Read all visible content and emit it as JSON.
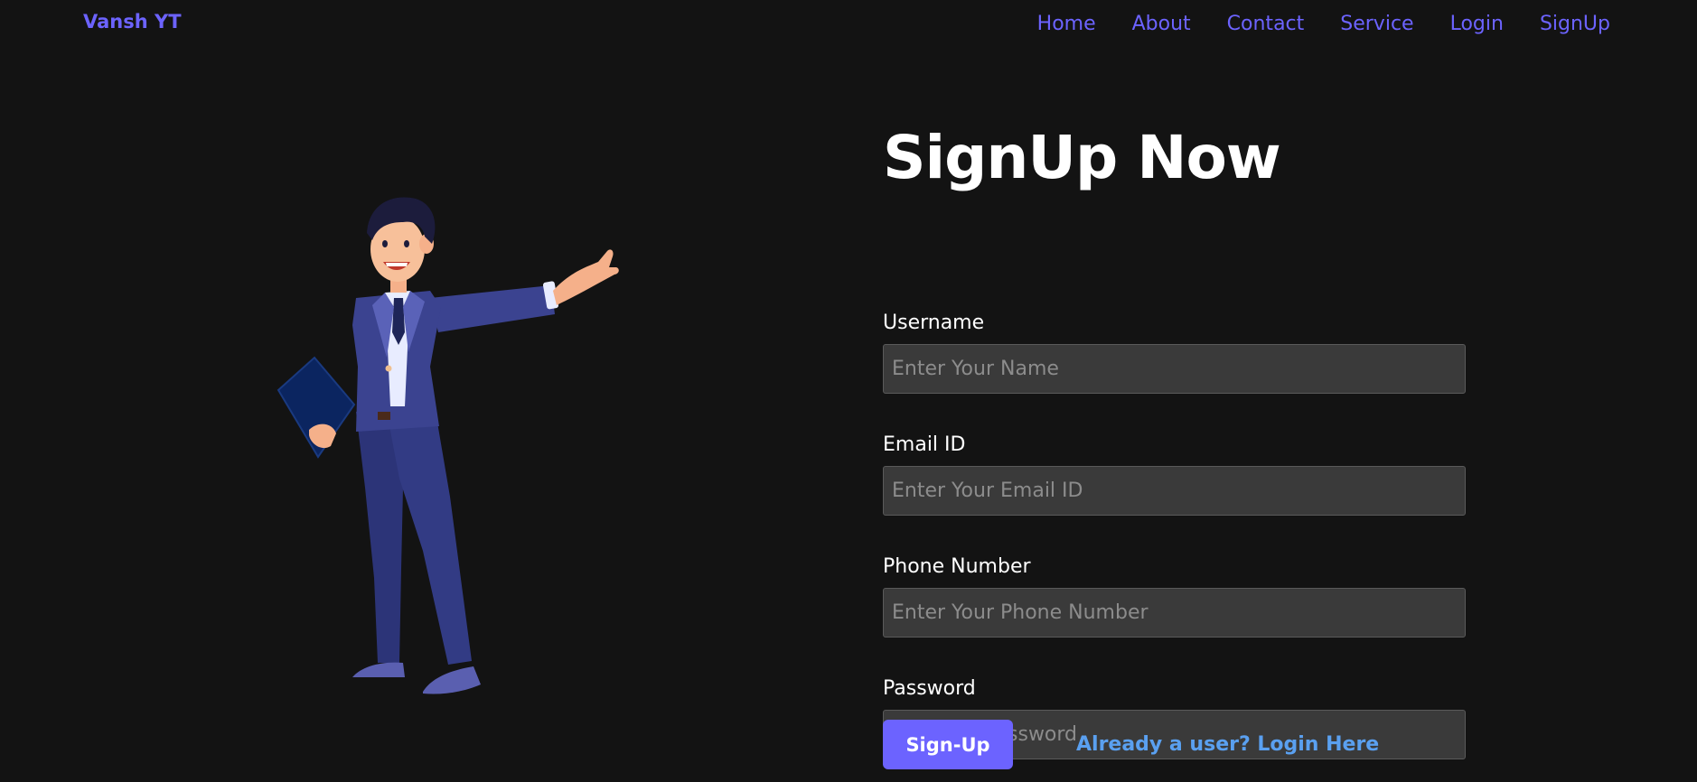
{
  "header": {
    "brand": "Vansh YT",
    "nav": [
      "Home",
      "About",
      "Contact",
      "Service",
      "Login",
      "SignUp"
    ]
  },
  "form": {
    "title": "SignUp Now",
    "fields": [
      {
        "label": "Username",
        "placeholder": "Enter Your Name",
        "value": ""
      },
      {
        "label": "Email ID",
        "placeholder": "Enter Your Email ID",
        "value": ""
      },
      {
        "label": "Phone Number",
        "placeholder": "Enter Your Phone Number",
        "value": ""
      },
      {
        "label": "Password",
        "placeholder": "Create a password",
        "value": ""
      }
    ],
    "submit_label": "Sign-Up",
    "login_link": "Already a user? Login Here"
  },
  "illustration": {
    "icon": "businessman-presenting-illustration"
  },
  "colors": {
    "background": "#131313",
    "accent": "#6c63ff",
    "link": "#5aa0f0",
    "input_bg": "#3a3a3a"
  }
}
